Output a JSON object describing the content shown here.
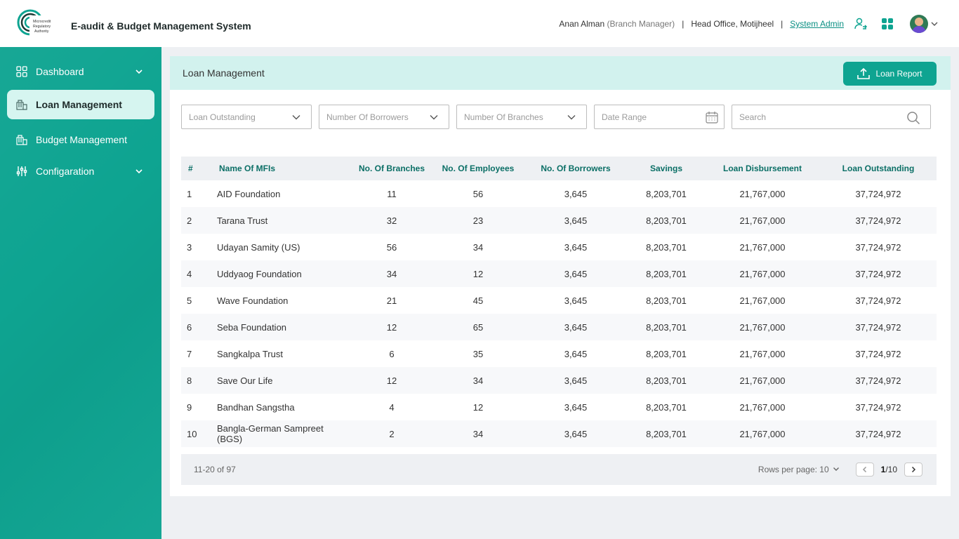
{
  "app": {
    "title": "E-audit & Budget Management System",
    "logo_text": "Microcredit Regulatory Authority"
  },
  "header": {
    "user_name": "Anan Alman",
    "user_role": "(Branch Manager)",
    "office_label": "Head Office,",
    "office_location": "Motijheel",
    "admin_link": "System Admin"
  },
  "sidebar": {
    "items": [
      {
        "label": "Dashboard",
        "icon": "grid-icon",
        "expandable": true
      },
      {
        "label": "Loan Management",
        "icon": "bank-icon",
        "active": true
      },
      {
        "label": "Budget Management",
        "icon": "building-icon"
      },
      {
        "label": "Configaration",
        "icon": "sliders-icon",
        "expandable": true
      }
    ]
  },
  "page": {
    "title": "Loan Management",
    "report_button": "Loan Report"
  },
  "filters": {
    "loan_outstanding": "Loan Outstanding",
    "borrowers": "Number Of Borrowers",
    "branches": "Number Of Branches",
    "date_range": "Date Range",
    "search_placeholder": "Search"
  },
  "table": {
    "headers": [
      "#",
      "Name Of MFIs",
      "No. Of Branches",
      "No. Of Employees",
      "No. Of Borrowers",
      "Savings",
      "Loan Disbursement",
      "Loan Outstanding"
    ],
    "rows": [
      [
        "1",
        "AID Foundation",
        "11",
        "56",
        "3,645",
        "8,203,701",
        "21,767,000",
        "37,724,972"
      ],
      [
        "2",
        "Tarana Trust",
        "32",
        "23",
        "3,645",
        "8,203,701",
        "21,767,000",
        "37,724,972"
      ],
      [
        "3",
        "Udayan Samity (US)",
        "56",
        "34",
        "3,645",
        "8,203,701",
        "21,767,000",
        "37,724,972"
      ],
      [
        "4",
        "Uddyaog Foundation",
        "34",
        "12",
        "3,645",
        "8,203,701",
        "21,767,000",
        "37,724,972"
      ],
      [
        "5",
        "Wave Foundation",
        "21",
        "45",
        "3,645",
        "8,203,701",
        "21,767,000",
        "37,724,972"
      ],
      [
        "6",
        "Seba Foundation",
        "12",
        "65",
        "3,645",
        "8,203,701",
        "21,767,000",
        "37,724,972"
      ],
      [
        "7",
        "Sangkalpa Trust",
        "6",
        "35",
        "3,645",
        "8,203,701",
        "21,767,000",
        "37,724,972"
      ],
      [
        "8",
        "Save Our Life",
        "12",
        "34",
        "3,645",
        "8,203,701",
        "21,767,000",
        "37,724,972"
      ],
      [
        "9",
        "Bandhan Sangstha",
        "4",
        "12",
        "3,645",
        "8,203,701",
        "21,767,000",
        "37,724,972"
      ],
      [
        "10",
        "Bangla-German Sampreet (BGS)",
        "2",
        "34",
        "3,645",
        "8,203,701",
        "21,767,000",
        "37,724,972"
      ]
    ]
  },
  "pagination": {
    "range": "11-20 of 97",
    "rows_per_page": "Rows per page: 10",
    "current": "1",
    "total": "/10"
  },
  "colors": {
    "brand": "#0ea491",
    "header_tint": "#d2f2ee",
    "accent_text": "#0b6f66"
  }
}
